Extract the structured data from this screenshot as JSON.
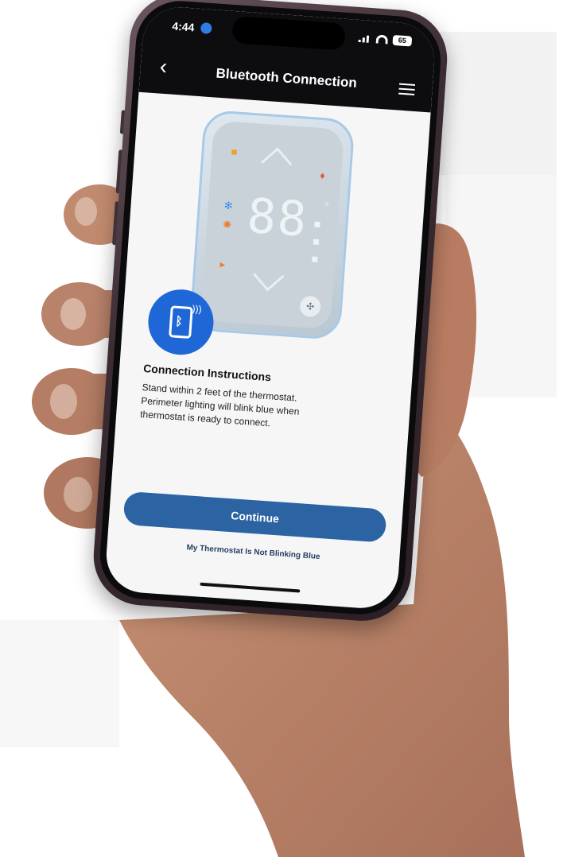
{
  "status_bar": {
    "time": "4:44",
    "battery": "65"
  },
  "header": {
    "back_label": "‹",
    "title": "Bluetooth Connection"
  },
  "thermostat": {
    "display": "88",
    "degree_symbol": "°"
  },
  "instructions": {
    "title": "Connection Instructions",
    "text": "Stand within 2 feet of the thermostat. Perimeter lighting will blink blue when thermostat is ready to connect."
  },
  "actions": {
    "continue_label": "Continue",
    "not_blinking_label": "My Thermostat Is Not Blinking Blue"
  },
  "colors": {
    "primary_button": "#2b63a3",
    "bluetooth_badge": "#1f67d6",
    "header_bg": "#0d0d10"
  },
  "icons": [
    "back-chevron-icon",
    "menu-icon",
    "bluetooth-phone-icon",
    "signal-icon",
    "wifi-icon",
    "battery-icon",
    "location-icon",
    "fan-icon"
  ]
}
